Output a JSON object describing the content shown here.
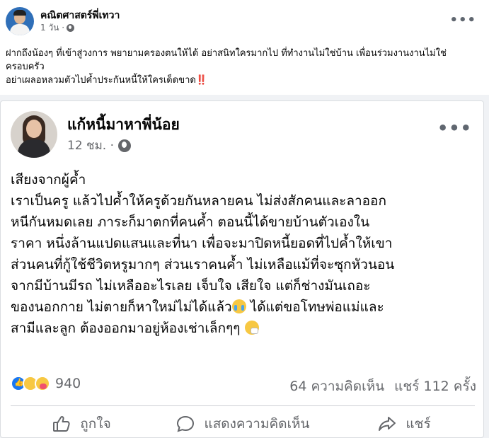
{
  "outer_post": {
    "author": "คณิตศาสตร์พี่เทวา",
    "time": "1 วัน ·",
    "text_lines": [
      "ฝากถึงน้องๆ ที่เข้าสู่วงการ พยายามครองตนให้ได้ อย่าสนิทใครมากไป ที่ทำงานไม่ใช่บ้าน เพื่อนร่วมงานงานไม่ใช่",
      "ครอบครัว",
      "อย่าเผลอหลวมตัวไปค้ำประกันหนี้ให้ใครเด็ดขาด"
    ],
    "exclamation_emoji": "‼️",
    "more_icon": "more-options-icon"
  },
  "shared_post": {
    "author": "แก้หนี้มาหาพี่น้อย",
    "time": "12 ชม. ·",
    "text_lines": [
      "เสียงจากผู้ค้ำ",
      "เราเป็นครู แล้วไปค้ำให้ครูด้วยกันหลายคน ไม่ส่งสักคนและลาออก",
      "หนีกันหมดเลย ภาระก็มาตกที่คนค้ำ ตอนนี้ได้ขายบ้านตัวเองใน",
      "ราคา หนึ่งล้านแปดแสนและที่นา เพื่อจะมาปิดหนี้ยอดที่ไปค้ำให้เขา",
      "ส่วนคนที่กู้ใช้ชีวิตหรูมากๆ ส่วนเราคนค้ำ ไม่เหลือแม้ที่จะซุกหัวนอน",
      "จากมีบ้านมีรถ ไม่เหลืออะไรเลย เจ็บใจ เสียใจ   แต่ก็ช่างมันเถอะ"
    ],
    "line7_before": "ของนอกกาย ไม่ตายก็หาใหม่ไม่ได้แล้ว",
    "line7_after": " ได้แต่ขอโทษพ่อแม่และ",
    "line8_before": "สามีและลูก ต้องออกมาอยู่ห้องเช่าเล็กๆๆ ",
    "reaction_count": "940",
    "comments": "64 ความคิดเห็น",
    "shares": "แชร์ 112 ครั้ง",
    "actions": {
      "like": "ถูกใจ",
      "comment": "แสดงความคิดเห็น",
      "share": "แชร์"
    }
  }
}
